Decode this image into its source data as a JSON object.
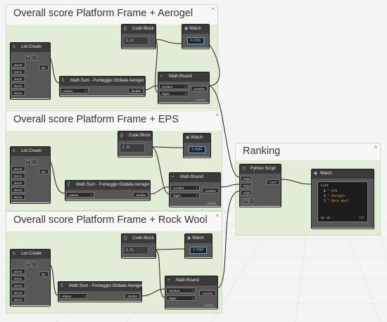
{
  "groups": {
    "aerogel": "Overall score Platform Frame + Aerogel",
    "eps": "Overall score Platform Frame + EPS",
    "rockwool": "Overall score Platform Frame + Rock Wool",
    "ranking": "Ranking"
  },
  "common": {
    "list_create": "List Create",
    "item0": "item0",
    "item1": "item1",
    "item2": "item2",
    "item3": "item3",
    "item4": "item4",
    "list_out": "list",
    "plus": "+",
    "minus": "-",
    "math_sum": "Math.Sum - Punteggio Globale Aerogel",
    "values": "values",
    "double": "double",
    "code_block": "Code Block",
    "code": "1.4;",
    "watch": "Watch",
    "math_round": "Math.Round",
    "number": "number",
    "digits": "digits",
    "auto": "AUTO",
    "gt": ">",
    "caret": "^"
  },
  "watches": {
    "aerogel_value": "4.0000",
    "eps_value": "4.3984",
    "rockwool_value": "4.7084"
  },
  "python": {
    "title": "Python Script",
    "in0": "IN[0]",
    "in1": "IN[1]",
    "in2": "IN[2]",
    "add": "+",
    "remove": "-",
    "out": "OUT"
  },
  "result_watch": {
    "title": "Watch",
    "list_label": "List",
    "rows": [
      {
        "index": "0",
        "text": "\" EPS"
      },
      {
        "index": "1",
        "text": "\" Aerogel"
      },
      {
        "index": "2",
        "text": "\" Rock Wool"
      }
    ],
    "footer_left": "@L @L",
    "footer_right": "{3}"
  }
}
